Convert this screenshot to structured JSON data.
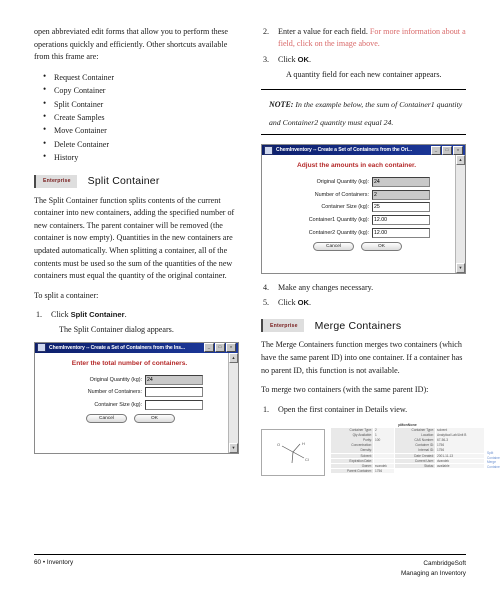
{
  "left_column": {
    "intro_paragraph": "open abbreviated edit forms that allow you to perform these operations quickly and efficiently. Other shortcuts available from this frame are:",
    "shortcut_list": [
      "Request Container",
      "Copy Container",
      "Split Container",
      "Create Samples",
      "Move Container",
      "Delete Container",
      "History"
    ],
    "section": {
      "badge": "Enterprise",
      "title": "Split Container"
    },
    "description": "The Split Container function splits contents of the current container into new containers, adding the specified number of new containers. The parent container will be removed (the container is now empty). Quantities in the new containers are updated automatically. When splitting a container, all of the contents must be used so the sum of the quantities of the new containers must equal the quantity of the original container.",
    "procedure_lead": "To split a container:",
    "step1_text": "Click ",
    "step1_bold": "Split Container",
    "step1_period": ".",
    "step1_sub": "The Split Container dialog appears."
  },
  "dialog_split": {
    "title": "ChemInventory -- Create a Set of Containers from the Ins...",
    "icon": "window-icon",
    "minimize": "_",
    "maximize": "□",
    "close": "×",
    "scroll_up": "▲",
    "scroll_down": "▼",
    "heading": "Enter the total number of containers.",
    "fields": [
      {
        "label": "Original Quantity (kg):",
        "value": "24",
        "readonly": true
      },
      {
        "label": "Number of Containers:",
        "value": "",
        "readonly": false
      },
      {
        "label": "Container Size (kg):",
        "value": "",
        "readonly": false
      }
    ],
    "cancel_label": "Cancel",
    "ok_label": "OK"
  },
  "right_column": {
    "step2_text": "Enter a value for each field. ",
    "step2_red": "For more information about a field, click on the image above.",
    "step3_text": "Click ",
    "step3_bold": "OK",
    "step3_period": ".",
    "step3_sub": "A quantity field for each new container appears.",
    "note_label": "NOTE:",
    "note_text": " In the example below, the sum of Container1 quantity and Container2 quantity must equal 24.",
    "step4": "Make any changes necessary.",
    "step5_text": "Click ",
    "step5_bold": "OK",
    "step5_period": ".",
    "section": {
      "badge": "Enterprise",
      "title": "Merge Containers"
    },
    "description": "The Merge Containers function merges two containers (which have the same parent ID) into one container. If a container has no parent ID, this function is not available.",
    "procedure_lead": "To merge two containers (with the same parent ID):",
    "step6": "Open the first container in Details view."
  },
  "dialog_adjust": {
    "title": "ChemInventory -- Create a Set of Containers from the Ori...",
    "icon": "window-icon",
    "minimize": "_",
    "maximize": "□",
    "close": "×",
    "scroll_up": "▲",
    "scroll_down": "▼",
    "heading": "Adjust the amounts in each container.",
    "fields": [
      {
        "label": "Original Quantity (kg):",
        "value": "24",
        "readonly": true
      },
      {
        "label": "Number of Containers:",
        "value": "2",
        "readonly": true
      },
      {
        "label": "Container Size (kg):",
        "value": "25",
        "readonly": false
      },
      {
        "label": "Container1 Quantity (kg):",
        "value": "12.00",
        "readonly": false
      },
      {
        "label": "Container2 Quantity (kg):",
        "value": "12.00",
        "readonly": false
      }
    ],
    "cancel_label": "Cancel",
    "ok_label": "OK"
  },
  "details_figure": {
    "structure_alt": "chemical-structure",
    "table_title": "pMonNone",
    "rows": [
      {
        "l1": "Container Type:",
        "v1": "2",
        "l2": "Container Type:",
        "v2": "solvent"
      },
      {
        "l2b": "Qty Available:",
        "v1": "1",
        "l2": "Location:",
        "v2": "Analytical Lab/Unit B"
      },
      {
        "l1": "Purity:",
        "v1": "100",
        "l2": "CAS Number:",
        "v2": "67-56-3"
      },
      {
        "l1": "Concentration:",
        "v1": "",
        "l2": "Container ID:",
        "v2": "1756"
      },
      {
        "l1": "Density:",
        "v1": "",
        "l2": "Internal ID:",
        "v2": "1756"
      },
      {
        "l1": "Solvent:",
        "v1": "",
        "l2": "Date Created:",
        "v2": "2001-11-13"
      },
      {
        "l1": "Expiration Date:",
        "v1": "",
        "l2": "Current User:",
        "v2": "dvandek"
      },
      {
        "l1": "Owner:",
        "v1": "svandek",
        "l2": "Status:",
        "v2": "available"
      },
      {
        "l1": "Parent Container:",
        "v1": "1756",
        "l2": "",
        "v2": ""
      }
    ],
    "links": [
      "Split Container",
      "Merge Containers"
    ]
  },
  "footer": {
    "left": "60 • Inventory",
    "right_line1": "CambridgeSoft",
    "right_line2": "Managing an Inventory"
  },
  "colors": {
    "red_link": "#d96a6a",
    "dialog_heading_red": "#b52b2b",
    "titlebar_blue": "#16297f",
    "badge_bg": "#dedede",
    "badge_text": "#7a2020"
  }
}
